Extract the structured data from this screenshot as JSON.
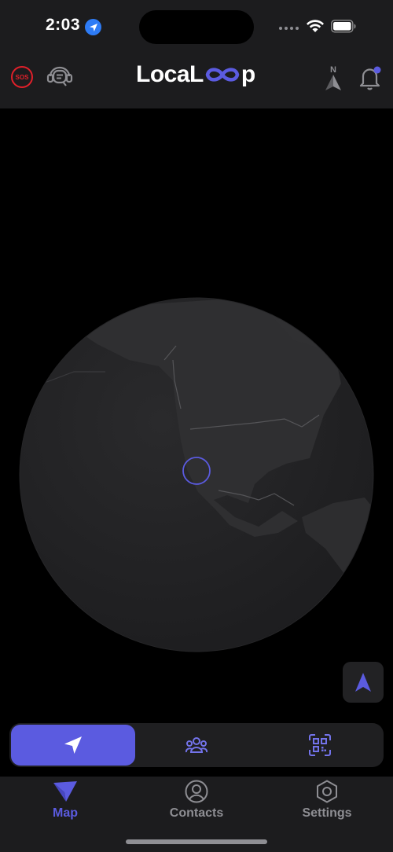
{
  "status_bar": {
    "time": "2:03",
    "location_icon": "location-arrow-icon",
    "wifi_icon": "wifi-icon",
    "battery_icon": "battery-icon"
  },
  "header": {
    "logo_text_left": "LocaL",
    "logo_text_right": "p",
    "sos_label": "SOS",
    "compass_label": "N",
    "icons": [
      "sos-icon",
      "support-chat-icon",
      "compass-north-icon",
      "bell-icon"
    ]
  },
  "colors": {
    "accent": "#5b5be0",
    "sos_red": "#e0202a",
    "background": "#000000",
    "panel": "#1c1c1e"
  },
  "map": {
    "recenter_icon": "navigation-arrow-icon"
  },
  "mode_bar": {
    "buttons": [
      {
        "icon": "send-location-icon",
        "active": true
      },
      {
        "icon": "group-icon",
        "active": false
      },
      {
        "icon": "qr-scan-icon",
        "active": false
      }
    ]
  },
  "tab_bar": {
    "tabs": [
      {
        "label": "Map",
        "icon": "map-arrow-icon",
        "active": true
      },
      {
        "label": "Contacts",
        "icon": "contact-icon",
        "active": false
      },
      {
        "label": "Settings",
        "icon": "settings-hex-icon",
        "active": false
      }
    ]
  }
}
